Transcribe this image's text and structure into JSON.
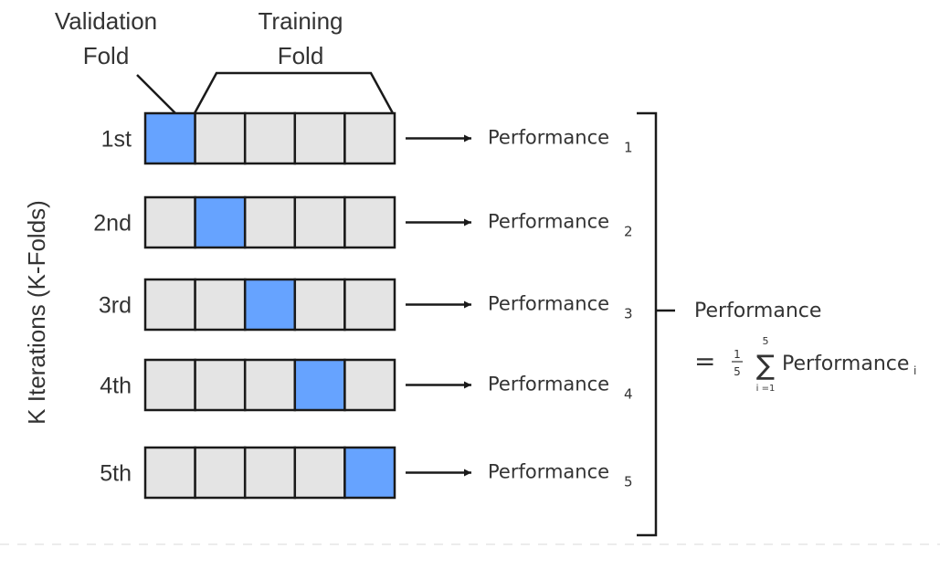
{
  "header": {
    "validation_label_line1": "Validation",
    "validation_label_line2": "Fold",
    "training_label_line1": "Training",
    "training_label_line2": "Fold"
  },
  "y_axis_label": "K Iterations (K-Folds)",
  "folds_per_iteration": 5,
  "colors": {
    "validation": "#66a3ff",
    "training": "#e4e4e4",
    "stroke": "#1a1a1a",
    "text": "#333333"
  },
  "iterations": [
    {
      "label": "1st",
      "validation_index": 0,
      "perf_label": "Performance",
      "perf_sub": "1"
    },
    {
      "label": "2nd",
      "validation_index": 1,
      "perf_label": "Performance",
      "perf_sub": "2"
    },
    {
      "label": "3rd",
      "validation_index": 2,
      "perf_label": "Performance",
      "perf_sub": "3"
    },
    {
      "label": "4th",
      "validation_index": 3,
      "perf_label": "Performance",
      "perf_sub": "4"
    },
    {
      "label": "5th",
      "validation_index": 4,
      "perf_label": "Performance",
      "perf_sub": "5"
    }
  ],
  "summary": {
    "title": "Performance",
    "equals": "=",
    "frac_num": "1",
    "frac_den": "5",
    "sigma": "∑",
    "sum_upper": "5",
    "sum_lower": "i =1",
    "term": "Performance",
    "term_sub": "i"
  }
}
